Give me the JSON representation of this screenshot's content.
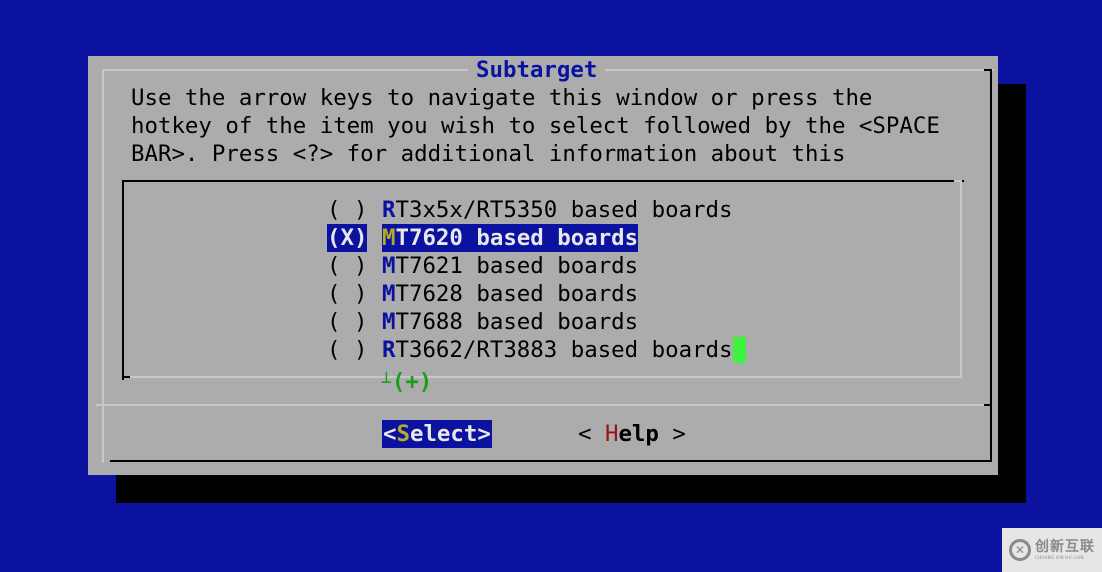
{
  "dialog": {
    "title": "Subtarget",
    "prompt_lines": [
      "Use the arrow keys to navigate this window or press the",
      "hotkey of the item you wish to select followed by the <SPACE",
      "BAR>. Press <?> for additional information about this"
    ]
  },
  "items": [
    {
      "radio": "( )",
      "hotkey": "R",
      "rest": "T3x5x/RT5350 based boards",
      "selected": false
    },
    {
      "radio": "(X)",
      "hotkey": "M",
      "rest": "T7620 based boards",
      "selected": true
    },
    {
      "radio": "( )",
      "hotkey": "M",
      "rest": "T7621 based boards",
      "selected": false
    },
    {
      "radio": "( )",
      "hotkey": "M",
      "rest": "T7628 based boards",
      "selected": false
    },
    {
      "radio": "( )",
      "hotkey": "M",
      "rest": "T7688 based boards",
      "selected": false
    },
    {
      "radio": "( )",
      "hotkey": "R",
      "rest": "T3662/RT3883 based boards",
      "selected": false
    }
  ],
  "more_indicator": {
    "tee": "⊥",
    "text": "(+)"
  },
  "buttons": {
    "select": {
      "open": "<",
      "hotkey": "S",
      "rest": "elect",
      "close": ">"
    },
    "help": {
      "open": "< ",
      "hotkey": "H",
      "rest": "elp",
      "close": " >"
    }
  },
  "watermark": {
    "icon": "logo-x-icon",
    "cn": "创新互联",
    "en": "CHUANG XIN HU LIAN"
  },
  "colors": {
    "background": "#0a129f",
    "dialog": "#acacac",
    "highlight": "#0a129f",
    "hotkey_selected": "#b5a92a",
    "help_hotkey": "#9c1010",
    "cursor": "#3ef43e",
    "more": "#18a018"
  }
}
